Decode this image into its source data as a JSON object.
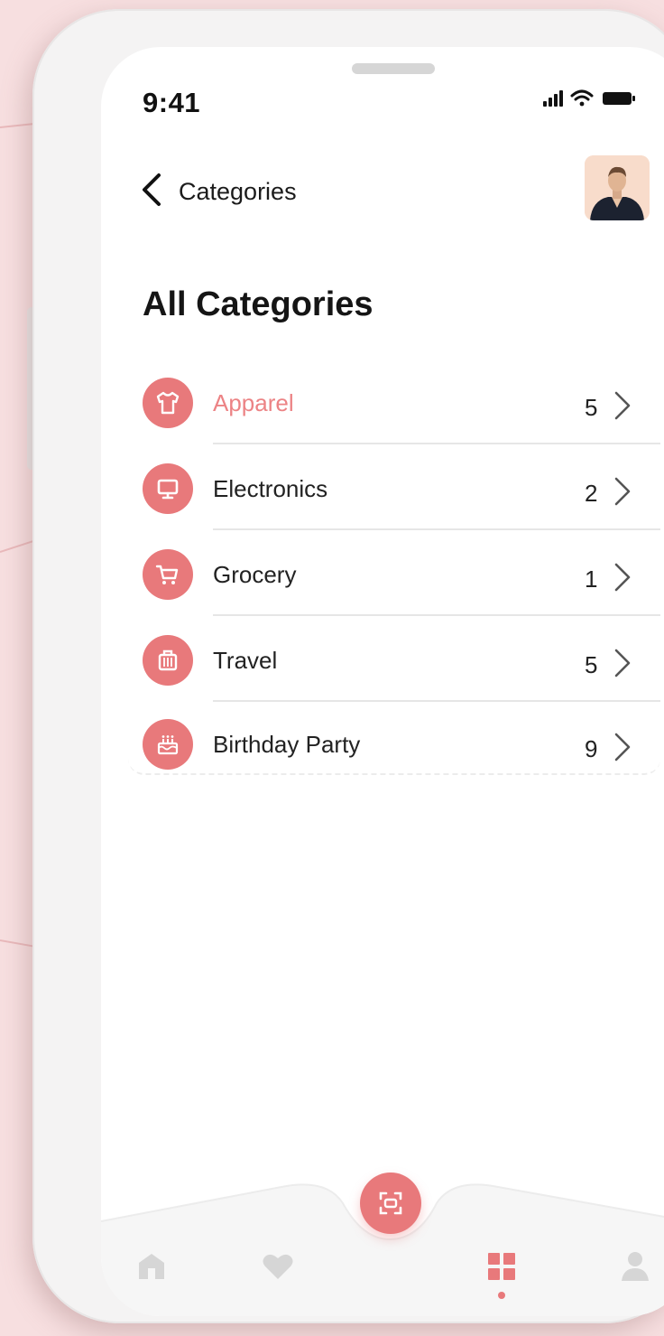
{
  "status_bar": {
    "time": "9:41"
  },
  "header": {
    "title": "Categories"
  },
  "section": {
    "title": "All Categories"
  },
  "categories": [
    {
      "label": "Apparel",
      "count": "5",
      "icon": "shirt-icon",
      "active": true
    },
    {
      "label": "Electronics",
      "count": "2",
      "icon": "monitor-icon",
      "active": false
    },
    {
      "label": "Grocery",
      "count": "1",
      "icon": "cart-icon",
      "active": false
    },
    {
      "label": "Travel",
      "count": "5",
      "icon": "suitcase-icon",
      "active": false
    },
    {
      "label": "Birthday Party",
      "count": "9",
      "icon": "cake-icon",
      "active": false
    }
  ],
  "bottom_nav": {
    "items": [
      "home-icon",
      "heart-icon",
      "scan-icon",
      "grid-icon",
      "user-icon"
    ],
    "selected": "grid-icon"
  },
  "colors": {
    "accent": "#e8797b",
    "active_text": "#ec8385",
    "background": "#f7dfe0"
  }
}
